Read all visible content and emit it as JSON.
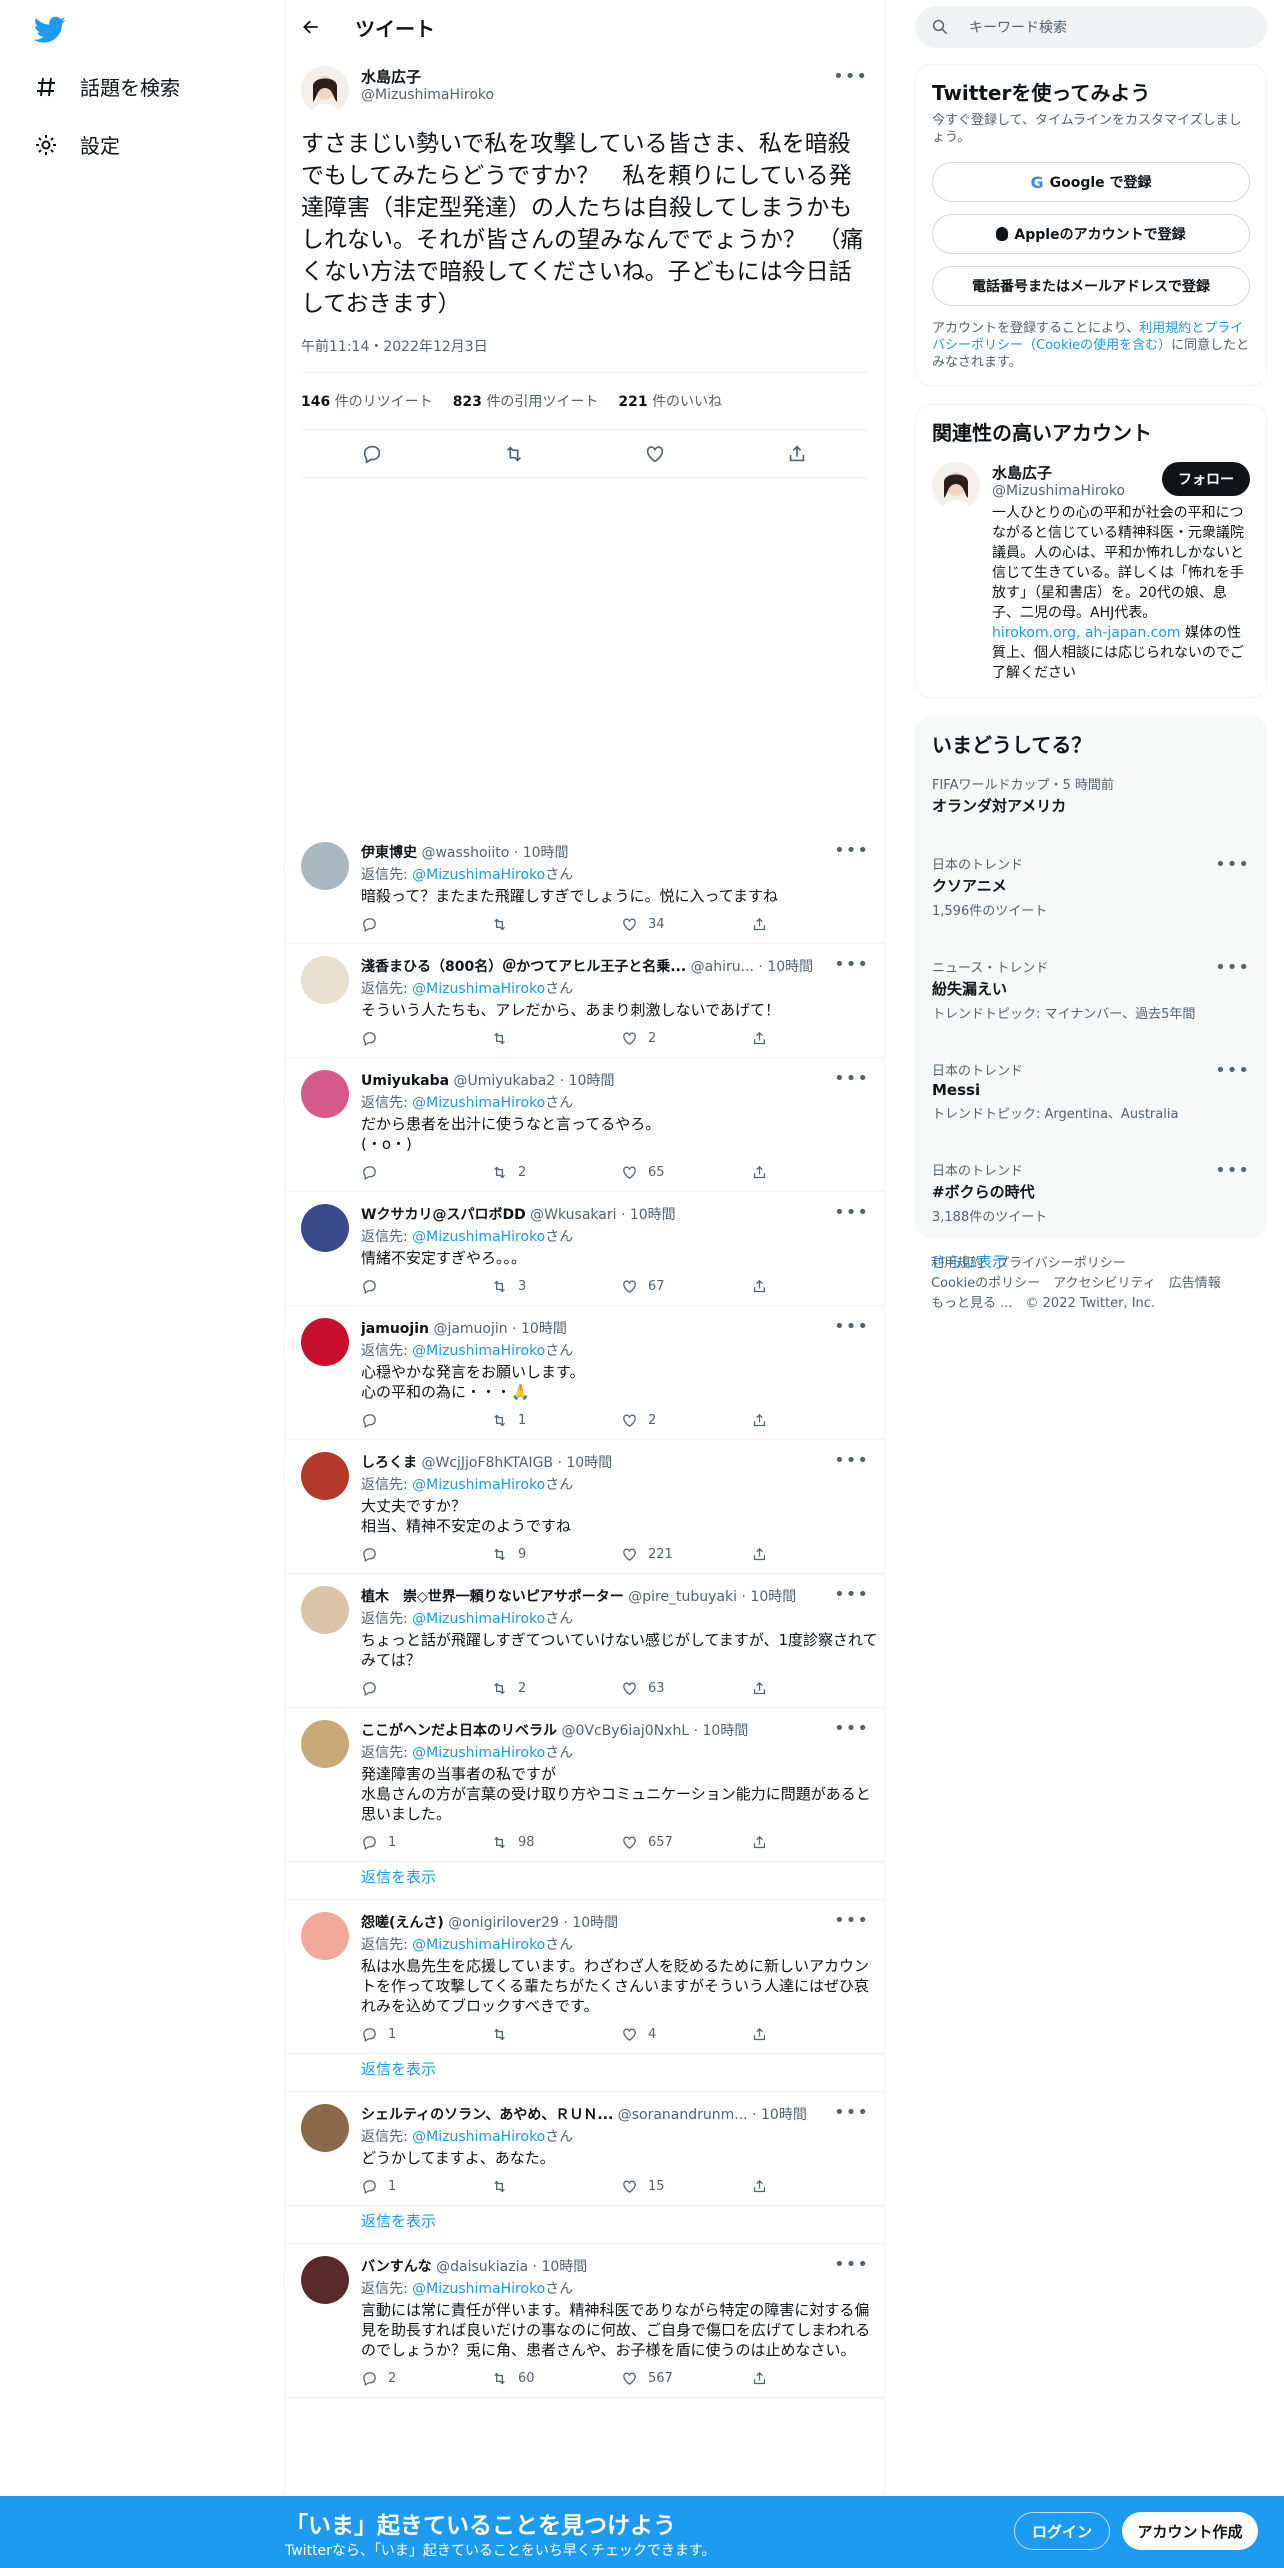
{
  "nav": {
    "explore": "話題を検索",
    "settings": "設定"
  },
  "header": {
    "title": "ツイート"
  },
  "tweet": {
    "name": "水島広子",
    "handle": "@MizushimaHiroko",
    "text": "すさまじい勢いで私を攻撃している皆さま、私を暗殺でもしてみたらどうですか？　私を頼りにしている発達障害（非定型発達）の人たちは自殺してしまうかもしれない。それが皆さんの望みなんででょうか？　（痛くない方法で暗殺してくださいね。子どもには今日話しておきます）",
    "time": "午前11:14・2022年12月3日",
    "retweets": "146",
    "retweets_label": "件のリツイート",
    "quotes": "823",
    "quotes_label": "件の引用ツイート",
    "likes": "221",
    "likes_label": "件のいいね"
  },
  "replies": [
    {
      "name": "伊東博史",
      "handle": "@wasshoiito",
      "time": "10時間",
      "to": "@MizushimaHiroko",
      "text": "暗殺って？またまた飛躍しすぎでしょうに。悦に入ってますね",
      "reply": "",
      "rt": "",
      "like": "34",
      "avatar_color": "#aab8c2"
    },
    {
      "name": "淺香まひる（800名）＠かつてアヒル王子と名乗...",
      "handle": "@ahiru...",
      "time": "10時間",
      "to": "@MizushimaHiroko",
      "text": "そういう人たちも、アレだから、あまり刺激しないであげて！",
      "reply": "",
      "rt": "",
      "like": "2",
      "avatar_color": "#e8dfd0"
    },
    {
      "name": "Umiyukaba",
      "handle": "@Umiyukaba2",
      "time": "10時間",
      "to": "@MizushimaHiroko",
      "text": "だから患者を出汁に使うなと言ってるやろ。\n(・o・)",
      "reply": "",
      "rt": "2",
      "like": "65",
      "avatar_color": "#d45a8a"
    },
    {
      "name": "Wクサカリ@スパロボDD",
      "handle": "@Wkusakari",
      "time": "10時間",
      "to": "@MizushimaHiroko",
      "text": "情緒不安定すぎやろ。。。",
      "reply": "",
      "rt": "3",
      "like": "67",
      "avatar_color": "#3a4a8a"
    },
    {
      "name": "jamuojin",
      "handle": "@jamuojin",
      "time": "10時間",
      "to": "@MizushimaHiroko",
      "text": "心穏やかな発言をお願いします。\n心の平和の為に・・・🙏",
      "reply": "",
      "rt": "1",
      "like": "2",
      "avatar_color": "#c8102e"
    },
    {
      "name": "しろくま",
      "handle": "@WcjJjoF8hKTAIGB",
      "time": "10時間",
      "to": "@MizushimaHiroko",
      "text": "大丈夫ですか？\n相当、精神不安定のようですね",
      "reply": "",
      "rt": "9",
      "like": "221",
      "avatar_color": "#b33a2a"
    },
    {
      "name": "植木　崇◇世界一頼りないピアサポーター",
      "handle": "@pire_tubuyaki",
      "time": "10時間",
      "to": "@MizushimaHiroko",
      "text": "ちょっと話が飛躍しすぎてついていけない感じがしてますが、1度診察されてみては？",
      "reply": "",
      "rt": "2",
      "like": "63",
      "avatar_color": "#d9c4a8"
    },
    {
      "name": "ここがヘンだよ日本のリベラル",
      "handle": "@0VcBy6iaj0NxhL",
      "time": "10時間",
      "to": "@MizushimaHiroko",
      "text": "発達障害の当事者の私ですが\n水島さんの方が言葉の受け取り方やコミュニケーション能力に問題があると思いました。",
      "reply": "1",
      "rt": "98",
      "like": "657",
      "avatar_color": "#c9a97a",
      "show": "返信を表示"
    },
    {
      "name": "怨嗟(えんさ)",
      "handle": "@onigirilover29",
      "time": "10時間",
      "to": "@MizushimaHiroko",
      "text": "私は水島先生を応援しています。わざわざ人を貶めるために新しいアカウントを作って攻撃してくる輩たちがたくさんいますがそういう人達にはぜひ哀れみを込めてブロックすべきです。",
      "reply": "1",
      "rt": "",
      "like": "4",
      "avatar_color": "#f2a89a",
      "show": "返信を表示"
    },
    {
      "name": "シェルティのソラン、あやめ、ＲＵＮ...",
      "handle": "@soranandrunm...",
      "time": "10時間",
      "to": "@MizushimaHiroko",
      "text": "どうかしてますよ、あなた。",
      "reply": "1",
      "rt": "",
      "like": "15",
      "avatar_color": "#8a6a4a",
      "show": "返信を表示"
    },
    {
      "name": "バンすんな",
      "handle": "@daisukiazia",
      "time": "10時間",
      "to": "@MizushimaHiroko",
      "text": "言動には常に責任が伴います。精神科医でありながら特定の障害に対する偏見を助長すれば良いだけの事なのに何故、ご自身で傷口を広げてしまわれるのでしょうか？兎に角、患者さんや、お子様を盾に使うのは止めなさい。",
      "reply": "2",
      "rt": "60",
      "like": "567",
      "avatar_color": "#5a2a2a"
    }
  ],
  "reply_to_label": "返信先:",
  "reply_to_suffix": "さん",
  "search": {
    "placeholder": "キーワード検索"
  },
  "signup": {
    "title": "Twitterを使ってみよう",
    "subtitle": "今すぐ登録して、タイムラインをカスタマイズしましょう。",
    "google": "Google で登録",
    "apple": "Appleのアカウントで登録",
    "phone": "電話番号またはメールアドレスで登録",
    "terms_pre": "アカウントを登録することにより、",
    "terms_link": "利用規約とプライバシーポリシー（Cookieの使用を含む）",
    "terms_post": "に同意したとみなされます。"
  },
  "related": {
    "title": "関連性の高いアカウント",
    "name": "水島広子",
    "handle": "@MizushimaHiroko",
    "follow": "フォロー",
    "bio": "一人ひとりの心の平和が社会の平和につながると信じている精神科医・元衆議院議員。人の心は、平和か怖れしかないと信じて生きている。詳しくは「怖れを手放す」（星和書店）を。20代の娘、息子、二児の母。AHJ代表。",
    "links": "hirokom.org, ah-japan.com",
    "bio2": "媒体の性質上、個人相談には応じられないのでご了解ください"
  },
  "trends": {
    "title": "いまどうしてる？",
    "items": [
      {
        "cat": "FIFAワールドカップ・5 時間前",
        "t": "オランダ対アメリカ",
        "sub": "",
        "more": false
      },
      {
        "cat": "日本のトレンド",
        "t": "クソアニメ",
        "sub": "1,596件のツイート",
        "more": true
      },
      {
        "cat": "ニュース・トレンド",
        "t": "紛失漏えい",
        "sub": "トレンドトピック: マイナンバー、過去5年間",
        "more": true
      },
      {
        "cat": "日本のトレンド",
        "t": "Messi",
        "sub": "トレンドトピック: Argentina、Australia",
        "more": true
      },
      {
        "cat": "日本のトレンド",
        "t": "#ボクらの時代",
        "sub": "3,188件のツイート",
        "more": true
      }
    ],
    "show_more": "さらに表示"
  },
  "footer": {
    "line1": "利用規約　プライバシーポリシー",
    "line2": "Cookieのポリシー　アクセシビリティ　広告情報",
    "line3": "もっと見る ...　© 2022 Twitter, Inc."
  },
  "banner": {
    "title": "「いま」起きていることを見つけよう",
    "subtitle": "Twitterなら、「いま」起きていることをいち早くチェックできます。",
    "login": "ログイン",
    "signup": "アカウント作成"
  },
  "colors": {
    "accent": "#1d9bf0",
    "text": "#0f1419",
    "muted": "#536471"
  }
}
